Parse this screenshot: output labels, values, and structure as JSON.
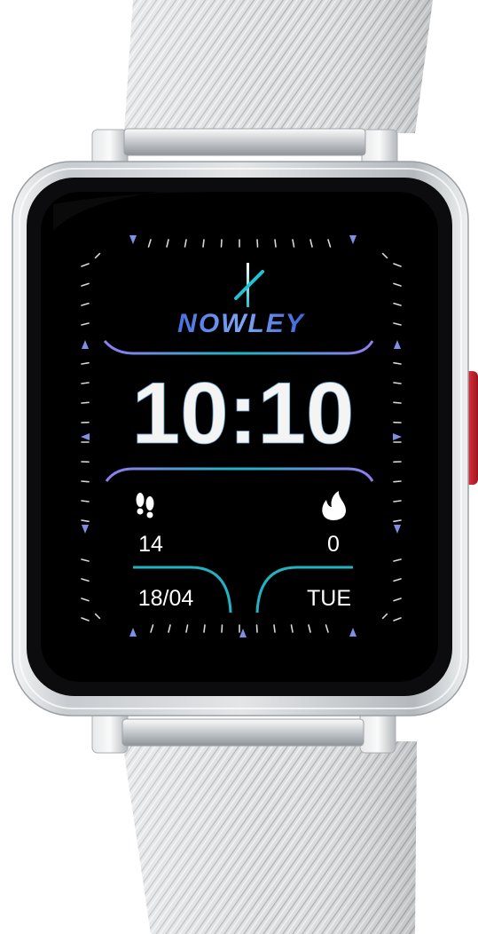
{
  "brand": "NOWLEY",
  "time": "10:10",
  "steps": "14",
  "calories": "0",
  "date": "18/04",
  "weekday": "TUE",
  "icons": {
    "brand_logo": "nowley-logo-icon",
    "steps": "footprints-icon",
    "calories": "flame-icon"
  },
  "colors": {
    "screen": "#000000",
    "bezel": "#0c0c0e",
    "case": "#c9ccd0",
    "button": "#cc2230",
    "accent_cyan": "#22b3c2",
    "accent_purple": "#8f7cf0",
    "tick_marker": "#7f8fe6"
  }
}
